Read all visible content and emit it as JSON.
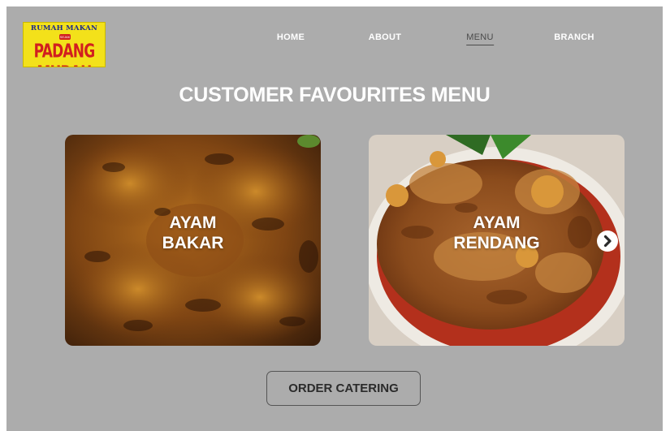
{
  "logo": {
    "top_text": "RUMAH MAKAN",
    "badge_text": "SEJAK",
    "bottom_text": "PADANG MURAH"
  },
  "nav": {
    "items": [
      {
        "label": "HOME",
        "active": false
      },
      {
        "label": "ABOUT",
        "active": false
      },
      {
        "label": "MENU",
        "active": true
      },
      {
        "label": "BRANCH",
        "active": false
      }
    ]
  },
  "section": {
    "title": "CUSTOMER FAVOURITES MENU"
  },
  "menu_items": [
    {
      "line1": "AYAM",
      "line2": "BAKAR"
    },
    {
      "line1": "AYAM",
      "line2": "RENDANG"
    }
  ],
  "carousel": {
    "next_icon": "chevron-right-circle-icon"
  },
  "cta": {
    "label": "ORDER CATERING"
  },
  "colors": {
    "background": "#acacac",
    "logo_yellow": "#f3e11a",
    "logo_red": "#d11f1f",
    "logo_blue": "#1c2a8c",
    "text_white": "#ffffff",
    "active_nav": "#4a4a4a"
  }
}
